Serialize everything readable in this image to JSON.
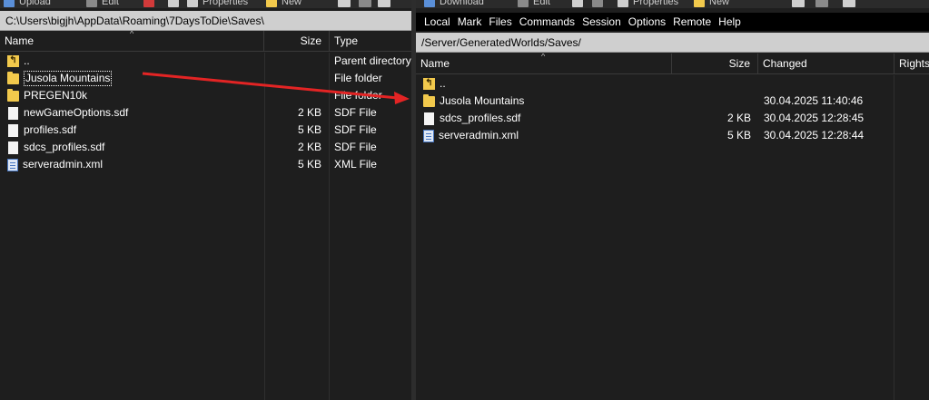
{
  "left": {
    "toolbar": [
      "Upload",
      "Edit",
      "Properties",
      "New"
    ],
    "path": "C:\\Users\\bigjh\\AppData\\Roaming\\7DaysToDie\\Saves\\",
    "columns": {
      "name": "Name",
      "size": "Size",
      "type": "Type"
    },
    "files": [
      {
        "name": "..",
        "size": "",
        "type": "Parent directory",
        "icon": "parent-folder-icon"
      },
      {
        "name": "Jusola Mountains",
        "size": "",
        "type": "File folder",
        "icon": "folder-icon"
      },
      {
        "name": "PREGEN10k",
        "size": "",
        "type": "File folder",
        "icon": "folder-icon"
      },
      {
        "name": "newGameOptions.sdf",
        "size": "2 KB",
        "type": "SDF File",
        "icon": "file-icon"
      },
      {
        "name": "profiles.sdf",
        "size": "5 KB",
        "type": "SDF File",
        "icon": "file-icon"
      },
      {
        "name": "sdcs_profiles.sdf",
        "size": "2 KB",
        "type": "SDF File",
        "icon": "file-icon"
      },
      {
        "name": "serveradmin.xml",
        "size": "5 KB",
        "type": "XML File",
        "icon": "xml-file-icon"
      }
    ]
  },
  "right": {
    "toolbar": [
      "Download",
      "Edit",
      "Properties",
      "New"
    ],
    "menu": [
      "Local",
      "Mark",
      "Files",
      "Commands",
      "Session",
      "Options",
      "Remote",
      "Help"
    ],
    "path": "/Server/GeneratedWorlds/Saves/",
    "columns": {
      "name": "Name",
      "size": "Size",
      "changed": "Changed",
      "rights": "Rights"
    },
    "files": [
      {
        "name": "..",
        "size": "",
        "changed": "",
        "icon": "parent-folder-icon"
      },
      {
        "name": "Jusola Mountains",
        "size": "",
        "changed": "30.04.2025 11:40:46",
        "icon": "folder-icon"
      },
      {
        "name": "sdcs_profiles.sdf",
        "size": "2 KB",
        "changed": "30.04.2025 12:28:45",
        "icon": "file-icon"
      },
      {
        "name": "serveradmin.xml",
        "size": "5 KB",
        "changed": "30.04.2025 12:28:44",
        "icon": "xml-file-icon"
      }
    ]
  },
  "colors": {
    "arrow": "#e32424",
    "folder": "#f2c94c",
    "pathbar": "#cfcfcf"
  }
}
